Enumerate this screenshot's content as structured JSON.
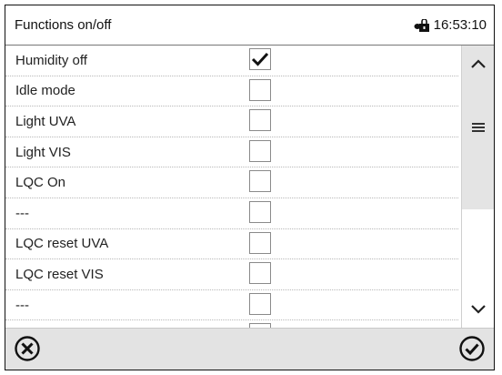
{
  "header": {
    "title": "Functions on/off",
    "time": "16:53:10",
    "lock_icon": "lock-icon"
  },
  "rows": [
    {
      "label": "Humidity off",
      "checked": true
    },
    {
      "label": "Idle mode",
      "checked": false
    },
    {
      "label": "Light UVA",
      "checked": false
    },
    {
      "label": "Light VIS",
      "checked": false
    },
    {
      "label": "LQC On",
      "checked": false
    },
    {
      "label": "---",
      "checked": false
    },
    {
      "label": "LQC reset UVA",
      "checked": false
    },
    {
      "label": "LQC reset VIS",
      "checked": false
    },
    {
      "label": "---",
      "checked": false
    },
    {
      "label": "",
      "checked": false
    }
  ],
  "scrollbar": {
    "up_icon": "chevron-up-icon",
    "grip_icon": "menu-icon",
    "down_icon": "chevron-down-icon"
  },
  "footer": {
    "cancel_icon": "cancel-icon",
    "confirm_icon": "confirm-icon"
  },
  "colors": {
    "footer_bg": "#e3e3e3",
    "scroll_thumb": "#e4e4e4"
  }
}
